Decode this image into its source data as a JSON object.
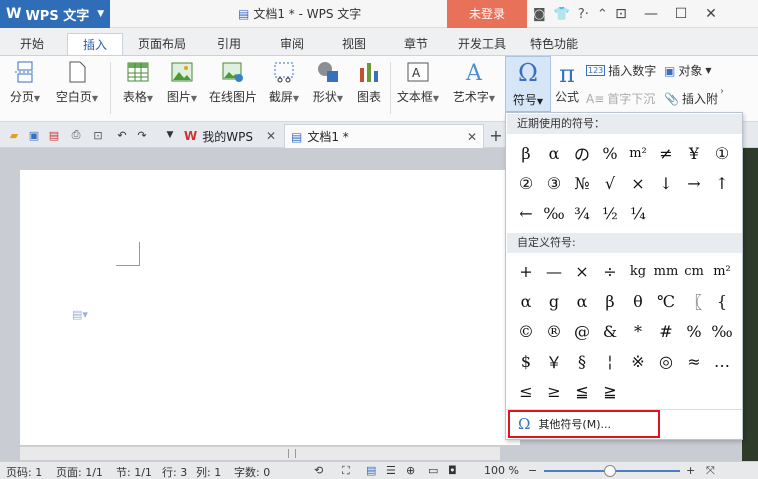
{
  "app": {
    "name": "WPS 文字",
    "doc_title": "文档1 * - WPS 文字",
    "login": "未登录"
  },
  "tabs": [
    "开始",
    "插入",
    "页面布局",
    "引用",
    "审阅",
    "视图",
    "章节",
    "开发工具",
    "特色功能"
  ],
  "active_tab": "插入",
  "ribbon": {
    "page_break": "分页",
    "blank_page": "空白页",
    "table": "表格",
    "picture": "图片",
    "online_picture": "在线图片",
    "screenshot": "截屏",
    "shape": "形状",
    "chart": "图表",
    "textbox": "文本框",
    "wordart": "艺术字",
    "symbol": "符号",
    "formula": "公式",
    "insert_number": "插入数字",
    "object": "对象",
    "drop_cap": "首字下沉",
    "insert_attach": "插入附"
  },
  "doc_tabs": {
    "my_wps": "我的WPS",
    "doc1": "文档1 *"
  },
  "dropdown": {
    "recent_header": "近期使用的符号：",
    "recent": [
      "β",
      "α",
      "の",
      "%",
      "m²",
      "≠",
      "¥",
      "①",
      "②",
      "③",
      "№",
      "√",
      "×",
      "↓",
      "→",
      "↑",
      "←",
      "‰",
      "¾",
      "½",
      "¼"
    ],
    "custom_header": "自定义符号:",
    "custom": [
      "+",
      "—",
      "×",
      "÷",
      "kg",
      "mm",
      "cm",
      "m²",
      "α",
      "g",
      "α",
      "β",
      "θ",
      "℃",
      "〖",
      "{",
      "©",
      "®",
      "@",
      "&",
      "*",
      "#",
      "%",
      "‰",
      "$",
      "￥",
      "§",
      "¦",
      "※",
      "◎",
      "≈",
      "…",
      "≤",
      "≥",
      "≦",
      "≧"
    ],
    "more": "其他符号(M)..."
  },
  "status": {
    "page": "页码: 1",
    "pages": "页面: 1/1",
    "section": "节: 1/1",
    "row": "行: 3",
    "col": "列: 1",
    "words": "字数: 0",
    "zoom": "100 %"
  }
}
